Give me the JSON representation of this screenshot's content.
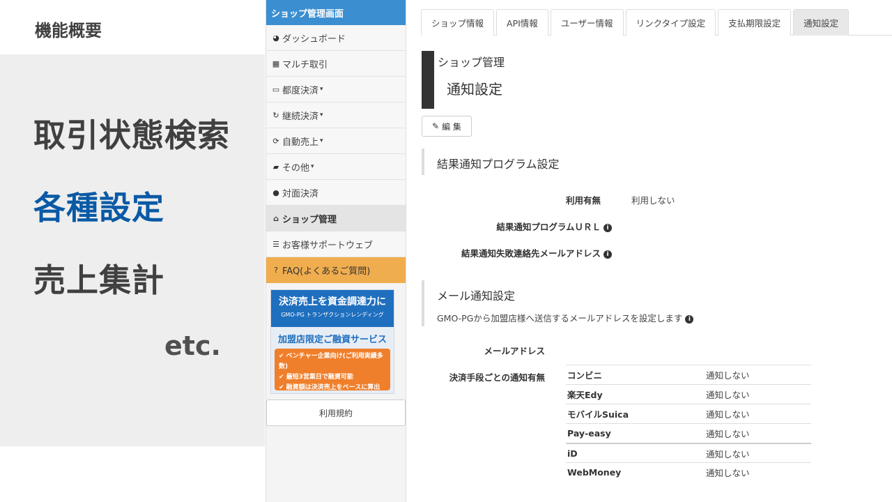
{
  "slide": {
    "title": "機能概要",
    "features": [
      "取引状態検索",
      "各種設定",
      "売上集計"
    ],
    "etc": "etc.",
    "highlight_color": "#0a5aa5"
  },
  "sidebar": {
    "header": "ショップ管理画面",
    "items": [
      {
        "icon": "dashboard-icon",
        "label": "ダッシュボード"
      },
      {
        "icon": "grid-icon",
        "label": "マルチ取引"
      },
      {
        "icon": "credit-card-icon",
        "label": "都度決済",
        "dropdown": true
      },
      {
        "icon": "refresh-icon",
        "label": "継続決済",
        "dropdown": true
      },
      {
        "icon": "sync-icon",
        "label": "自動売上",
        "dropdown": true
      },
      {
        "icon": "folder-icon",
        "label": "その他",
        "dropdown": true
      },
      {
        "icon": "user-icon",
        "label": "対面決済"
      },
      {
        "icon": "home-icon",
        "label": "ショップ管理",
        "active": true
      },
      {
        "icon": "list-icon",
        "label": "お客様サポートウェブ"
      },
      {
        "icon": "question-icon",
        "label": "FAQ(よくあるご質問)",
        "highlight": true
      }
    ],
    "banner": {
      "line1": "決済売上を資金調達力に",
      "line2": "GMO-PG トランザクションレンディング",
      "line3": "加盟店限定ご融資サービス",
      "bullets": [
        "✔ ベンチャー企業向け(ご利用実績多数)",
        "✔ 最短3営業日で融資可能",
        "✔ 融資額は決済売上をベースに算出"
      ]
    },
    "terms": "利用規約"
  },
  "tabs": [
    {
      "label": "ショップ情報"
    },
    {
      "label": "API情報"
    },
    {
      "label": "ユーザー情報"
    },
    {
      "label": "リンクタイプ設定"
    },
    {
      "label": "支払期限設定"
    },
    {
      "label": "通知設定",
      "active": true
    }
  ],
  "page": {
    "subtitle": "ショップ管理",
    "title": "通知設定",
    "edit_label": "編 集"
  },
  "result_section": {
    "title": "結果通知プログラム設定",
    "usage_label": "利用有無",
    "usage_value": "利用しない",
    "url_label": "結果通知プログラムＵＲＬ",
    "fail_mail_label": "結果通知失敗連絡先メールアドレス"
  },
  "mail_section": {
    "title": "メール通知設定",
    "desc": "GMO-PGから加盟店様へ送信するメールアドレスを設定します",
    "mail_label": "メールアドレス",
    "method_label": "決済手段ごとの通知有無",
    "methods": [
      {
        "name": "コンビニ",
        "value": "通知しない"
      },
      {
        "name": "楽天Edy",
        "value": "通知しない"
      },
      {
        "name": "モバイルSuica",
        "value": "通知しない"
      },
      {
        "name": "Pay-easy",
        "value": "通知しない"
      },
      {
        "name": "iD",
        "value": "通知しない"
      },
      {
        "name": "WebMoney",
        "value": "通知しない"
      }
    ]
  }
}
